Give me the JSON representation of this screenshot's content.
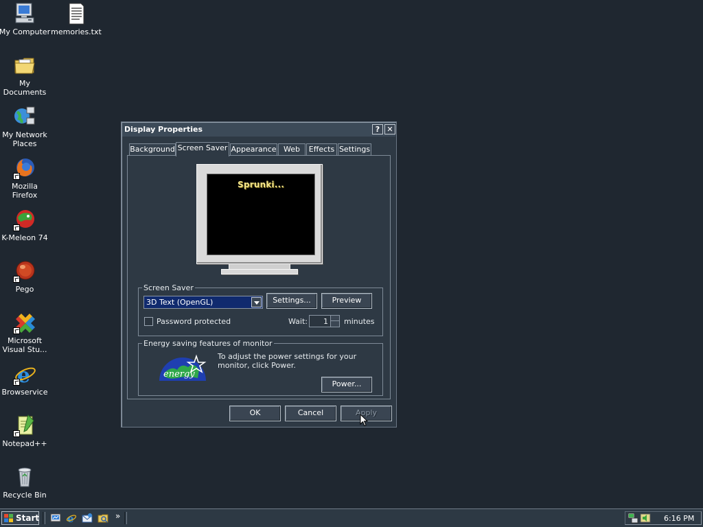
{
  "desktop": {
    "icons": [
      {
        "label": "My Computer",
        "icon": "my-computer-icon"
      },
      {
        "label": "memories.txt",
        "icon": "text-file-icon"
      },
      {
        "label": "My Documents",
        "icon": "folder-icon"
      },
      {
        "label": "My Network Places",
        "icon": "network-icon"
      },
      {
        "label": "Mozilla Firefox",
        "icon": "firefox-icon"
      },
      {
        "label": "K-Meleon 74",
        "icon": "kmeleon-icon"
      },
      {
        "label": "Pego",
        "icon": "pego-icon"
      },
      {
        "label": "Microsoft Visual Stu...",
        "icon": "visual-studio-icon"
      },
      {
        "label": "Browservice",
        "icon": "internet-explorer-icon"
      },
      {
        "label": "Notepad++",
        "icon": "notepadpp-icon"
      },
      {
        "label": "Recycle Bin",
        "icon": "recycle-bin-icon"
      }
    ]
  },
  "dialog": {
    "title": "Display Properties",
    "help_button": "?",
    "close_button": "✕",
    "tabs": [
      {
        "label": "Background",
        "active": false
      },
      {
        "label": "Screen Saver",
        "active": true
      },
      {
        "label": "Appearance",
        "active": false
      },
      {
        "label": "Web",
        "active": false
      },
      {
        "label": "Effects",
        "active": false
      },
      {
        "label": "Settings",
        "active": false
      }
    ],
    "preview_text": "Sprunki...",
    "screen_saver": {
      "group_label": "Screen Saver",
      "selected": "3D Text (OpenGL)",
      "settings_button": "Settings...",
      "preview_button": "Preview",
      "password_label": "Password protected",
      "password_checked": false,
      "wait_label": "Wait:",
      "wait_value": "1",
      "minutes_label": "minutes"
    },
    "energy": {
      "group_label": "Energy saving features of monitor",
      "text": "To adjust the power settings for your monitor, click Power.",
      "power_button": "Power...",
      "logo_text": "energy"
    },
    "buttons": {
      "ok": "OK",
      "cancel": "Cancel",
      "apply": "Apply"
    }
  },
  "taskbar": {
    "start_label": "Start",
    "quick_launch": [
      "show-desktop-icon",
      "internet-explorer-icon",
      "outlook-express-icon",
      "windows-explorer-icon"
    ],
    "overflow": "»",
    "clock": "6:16 PM"
  },
  "colors": {
    "desktop": "#1f2730",
    "dialog": "#2e3944",
    "selection": "#102a6e",
    "preview_text": "#f3e48a"
  }
}
